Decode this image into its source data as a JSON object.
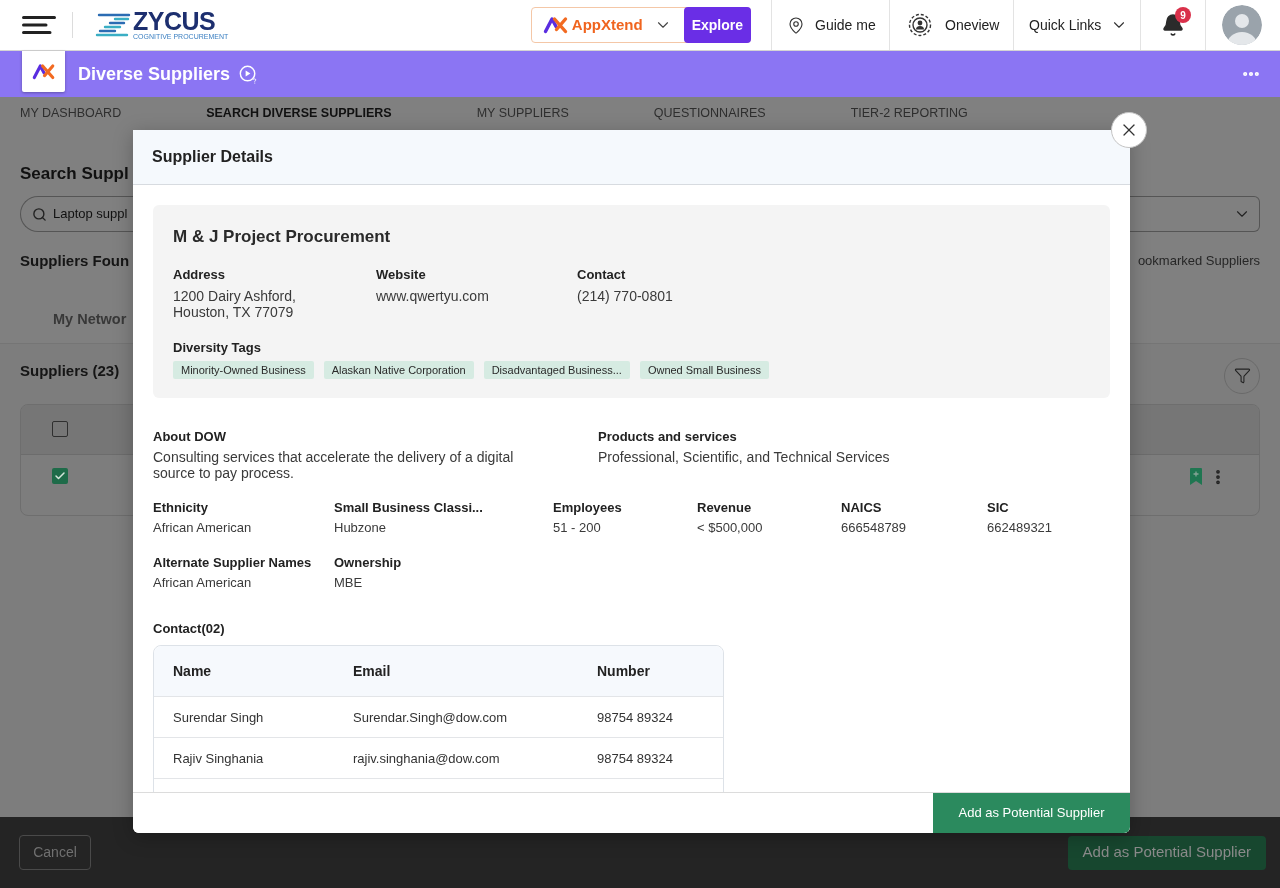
{
  "header": {
    "logo": {
      "name": "ZYCUS",
      "tagline": "COGNITIVE PROCUREMENT"
    },
    "app_switcher": {
      "label": "AppXtend",
      "action": "Explore"
    },
    "links": [
      {
        "kind": "guide",
        "label": "Guide me"
      },
      {
        "kind": "oneview",
        "label": "Oneview"
      },
      {
        "kind": "menu",
        "label": "Quick Links"
      }
    ],
    "notifications": {
      "count": "9"
    }
  },
  "app_bar": {
    "title": "Diverse Suppliers"
  },
  "nav_tabs": [
    {
      "label": "MY DASHBOARD",
      "selected": false
    },
    {
      "label": "SEARCH DIVERSE SUPPLIERS",
      "selected": true
    },
    {
      "label": "MY SUPPLIERS",
      "selected": false
    },
    {
      "label": "QUESTIONNAIRES",
      "selected": false
    },
    {
      "label": "TIER-2 REPORTING",
      "selected": false
    }
  ],
  "page": {
    "title": "Search Suppl",
    "search": {
      "value": "Laptop suppl"
    },
    "results_title": "Suppliers Foun",
    "bookmarked_link": "ookmarked Suppliers",
    "network_tab": "My Networ",
    "suppliers": {
      "title": "Suppliers (23)",
      "header_checked": false,
      "rows": [
        {
          "checked": true
        }
      ]
    }
  },
  "bottom_bar": {
    "buttons": [
      {
        "kind": "secondary",
        "label": "Cancel"
      },
      {
        "kind": "primary",
        "label": "Add as Potential Supplier"
      }
    ]
  },
  "modal": {
    "title": "Supplier Details",
    "supplier": {
      "name": "M & J Project Procurement",
      "fields": [
        {
          "label": "Address",
          "value": "1200 Dairy Ashford, Houston, TX 77079"
        },
        {
          "label": "Website",
          "value": "www.qwertyu.com"
        },
        {
          "label": "Contact",
          "value": "(214) 770-0801"
        }
      ],
      "diversity_tags": {
        "label": "Diversity Tags",
        "tags": [
          "Minority-Owned Business",
          "Alaskan Native Corporation",
          "Disadvantaged Business...",
          "Owned Small Business"
        ]
      }
    },
    "about": {
      "label": "About DOW",
      "value": "Consulting services that accelerate the delivery of a digital source to pay process."
    },
    "products": {
      "label": "Products and services",
      "value": "Professional, Scientific, and Technical Services"
    },
    "details": [
      {
        "label": "Ethnicity",
        "value": "African American"
      },
      {
        "label": "Small Business Classi...",
        "value": "Hubzone"
      },
      {
        "label": "Employees",
        "value": "51 - 200"
      },
      {
        "label": "Revenue",
        "value": "< $500,000"
      },
      {
        "label": "NAICS",
        "value": "666548789"
      },
      {
        "label": "SIC",
        "value": "662489321"
      },
      {
        "label": "Alternate Supplier Names",
        "value": "African American"
      },
      {
        "label": "Ownership",
        "value": "MBE"
      }
    ],
    "contacts": {
      "title": "Contact(02)",
      "columns": [
        "Name",
        "Email",
        "Number"
      ],
      "rows": [
        [
          "Surendar Singh",
          "Surendar.Singh@dow.com",
          "98754 89324"
        ],
        [
          "Rajiv Singhania",
          "rajiv.singhania@dow.com",
          "98754 89324"
        ]
      ]
    },
    "footer_button": "Add as Potential Supplier"
  }
}
